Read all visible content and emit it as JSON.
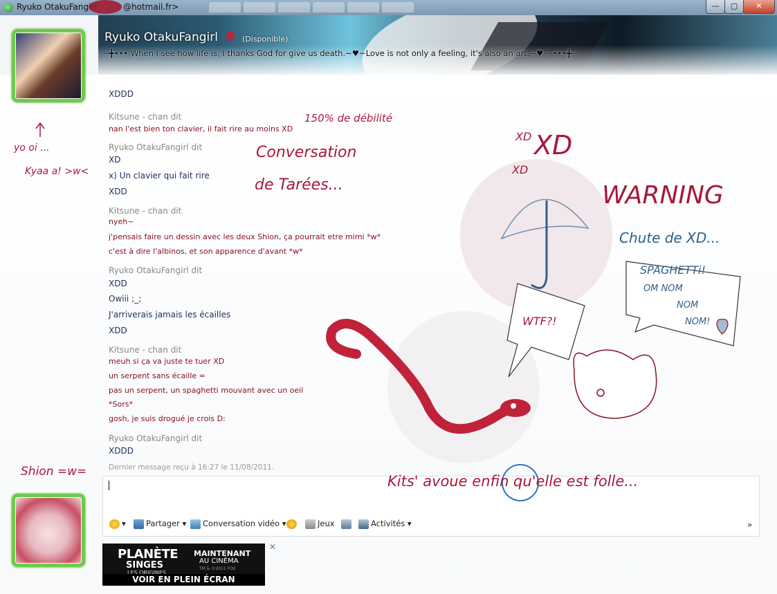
{
  "window": {
    "title": "Ryuko OtakuFangirl",
    "title_email_suffix": "@hotmail.fr>",
    "buttons": {
      "minimize": "—",
      "maximize": "▢",
      "close": "✕"
    }
  },
  "contact": {
    "name": "Ryuko OtakuFangirl",
    "status": "(Disponible)",
    "personal_message": "─╋••• When I see how life is, I thanks God for give us death.~♥~Love is not only a feeling, it's also an art.~♥~ •••╋─"
  },
  "messages": [
    {
      "kind": "msg-blue",
      "text": "XDDD"
    },
    {
      "kind": "sender",
      "text": "Kitsune - chan dit"
    },
    {
      "kind": "msg-red",
      "text": "nan l'est bien ton clavier, il fait rire au moins XD"
    },
    {
      "kind": "sender",
      "text": "Ryuko OtakuFangirl dit"
    },
    {
      "kind": "msg-blue",
      "text": "XD"
    },
    {
      "kind": "msg-blue",
      "text": "x) Un clavier qui fait rire"
    },
    {
      "kind": "msg-blue",
      "text": "XDD"
    },
    {
      "kind": "sender",
      "text": "Kitsune - chan dit"
    },
    {
      "kind": "msg-red",
      "text": "nyeh~"
    },
    {
      "kind": "msg-red",
      "text": "j'pensais faire un dessin avec les deux Shion, ça pourrait etre mimi *w*"
    },
    {
      "kind": "msg-red",
      "text": "c'est à dire l'albinos, et son apparence d'avant *w*"
    },
    {
      "kind": "sender",
      "text": "Ryuko OtakuFangirl dit"
    },
    {
      "kind": "msg-blue",
      "text": "XDD"
    },
    {
      "kind": "msg-blue",
      "text": "Owiii ;_;"
    },
    {
      "kind": "msg-blue",
      "text": "J'arriverais jamais les écailles"
    },
    {
      "kind": "msg-blue",
      "text": "XDD"
    },
    {
      "kind": "sender",
      "text": "Kitsune - chan dit"
    },
    {
      "kind": "msg-red",
      "text": "meuh si ça va juste te tuer XD"
    },
    {
      "kind": "msg-red",
      "text": "un serpent sans écaille ="
    },
    {
      "kind": "msg-red",
      "text": "pas un serpent, un spaghetti mouvant avec un oeil"
    },
    {
      "kind": "msg-red",
      "text": "*Sors*"
    },
    {
      "kind": "msg-red",
      "text": "gosh, je suis drogué je crois D:"
    },
    {
      "kind": "sender",
      "text": "Ryuko OtakuFangirl dit"
    },
    {
      "kind": "msg-blue",
      "text": "XDDD"
    },
    {
      "kind": "stamp",
      "text": "Dernier message reçu à 16:27 le 11/08/2011."
    }
  ],
  "toolbar": {
    "share": "Partager ▾",
    "video": "Conversation vidéo ▾",
    "games": "Jeux",
    "activities": "Activités ▾",
    "expand": "»"
  },
  "ad": {
    "line1": "PLANÈTE",
    "line2": "SINGES",
    "line3": "LES ORIGINES",
    "now": "MAINTENANT",
    "cinema": "AU CINÉMA",
    "legal": "TM & ©2011 FOX",
    "cta": "VOIR EN PLEIN ÉCRAN",
    "close": "✕"
  },
  "annotations": {
    "yoi": "yo oi ...",
    "kyaa": "Kyaa a! >w<",
    "shion": "Shion =w=",
    "percent": "150% de débilité",
    "conversation": "Conversation",
    "tarees": "de Tarées...",
    "xd_small1": "XD",
    "xd_big": "XD",
    "xd_small2": "XD",
    "warning": "WARNING",
    "chute": "Chute de XD...",
    "spaghetti": "SPAGHETTi!",
    "om_nom": "OM NOM",
    "nom1": "NOM",
    "nom2": "NOM!",
    "wtf": "WTF?!",
    "kits": "Kits' avoue enfin qu'elle est folle..."
  },
  "colors": {
    "annotation_red": "#a8183a",
    "annotation_blue": "#2f5f8a",
    "avatar_frame": "#6ecb4a"
  }
}
